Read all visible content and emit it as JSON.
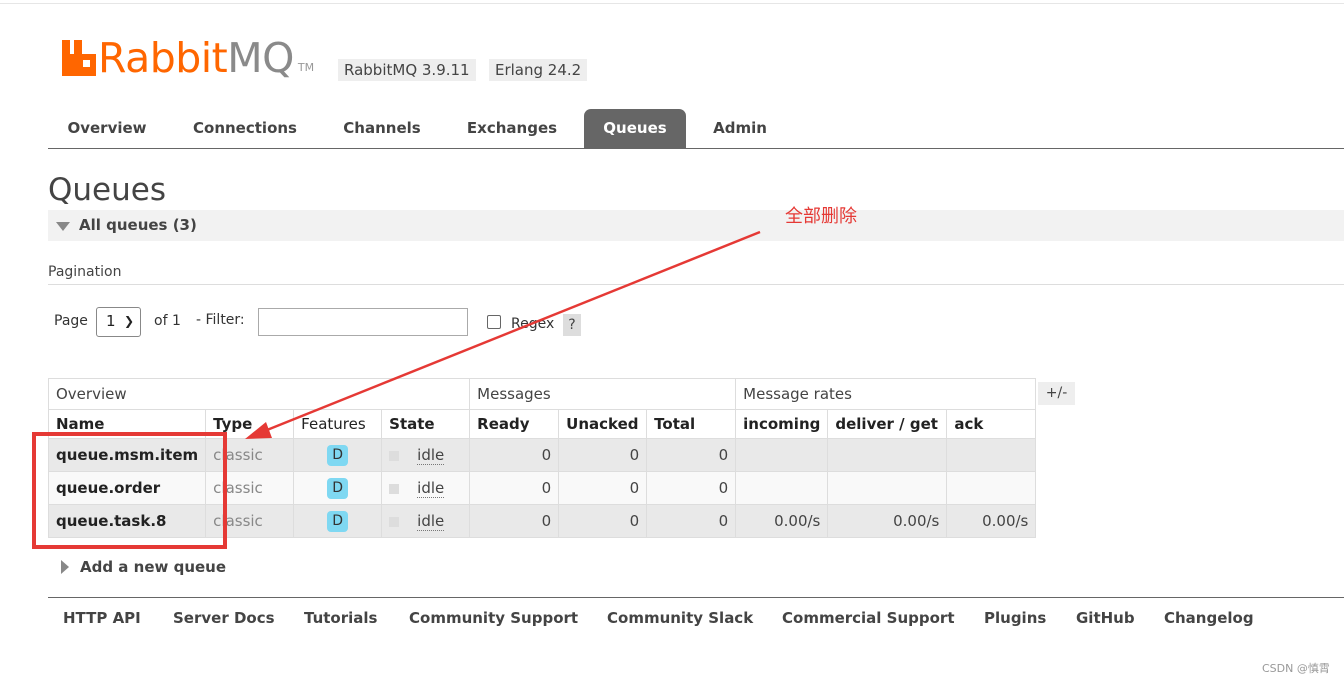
{
  "logo": {
    "rabbit": "Rabbit",
    "mq": "MQ",
    "tm": "TM"
  },
  "versions": {
    "rabbitmq": "RabbitMQ 3.9.11",
    "erlang": "Erlang 24.2"
  },
  "tabs": [
    "Overview",
    "Connections",
    "Channels",
    "Exchanges",
    "Queues",
    "Admin"
  ],
  "active_tab": "Queues",
  "page_title": "Queues",
  "section": {
    "label": "All queues (3)"
  },
  "pagination": {
    "label": "Pagination",
    "page_label": "Page",
    "page_value": "1",
    "of_label": "of 1",
    "filter_label": "- Filter:",
    "filter_value": "",
    "regex_label": "Regex",
    "help_label": "?"
  },
  "table": {
    "groups": [
      "Overview",
      "Messages",
      "Message rates"
    ],
    "columns": [
      "Name",
      "Type",
      "Features",
      "State",
      "Ready",
      "Unacked",
      "Total",
      "incoming",
      "deliver / get",
      "ack"
    ],
    "rows": [
      {
        "name": "queue.msm.item",
        "type": "classic",
        "feature": "D",
        "state": "idle",
        "ready": "0",
        "unacked": "0",
        "total": "0",
        "incoming": "",
        "deliver_get": "",
        "ack": ""
      },
      {
        "name": "queue.order",
        "type": "classic",
        "feature": "D",
        "state": "idle",
        "ready": "0",
        "unacked": "0",
        "total": "0",
        "incoming": "",
        "deliver_get": "",
        "ack": ""
      },
      {
        "name": "queue.task.8",
        "type": "classic",
        "feature": "D",
        "state": "idle",
        "ready": "0",
        "unacked": "0",
        "total": "0",
        "incoming": "0.00/s",
        "deliver_get": "0.00/s",
        "ack": "0.00/s"
      }
    ],
    "plusminus": "+/-"
  },
  "add_queue": "Add a new queue",
  "footer_links": [
    "HTTP API",
    "Server Docs",
    "Tutorials",
    "Community Support",
    "Community Slack",
    "Commercial Support",
    "Plugins",
    "GitHub",
    "Changelog"
  ],
  "annotation": {
    "text": "全部删除",
    "color": "#e53935"
  },
  "watermark": "CSDN @慎霄",
  "colors": {
    "brand": "#ff6600",
    "active_tab": "#666666",
    "feature_badge": "#7fd8f2"
  }
}
